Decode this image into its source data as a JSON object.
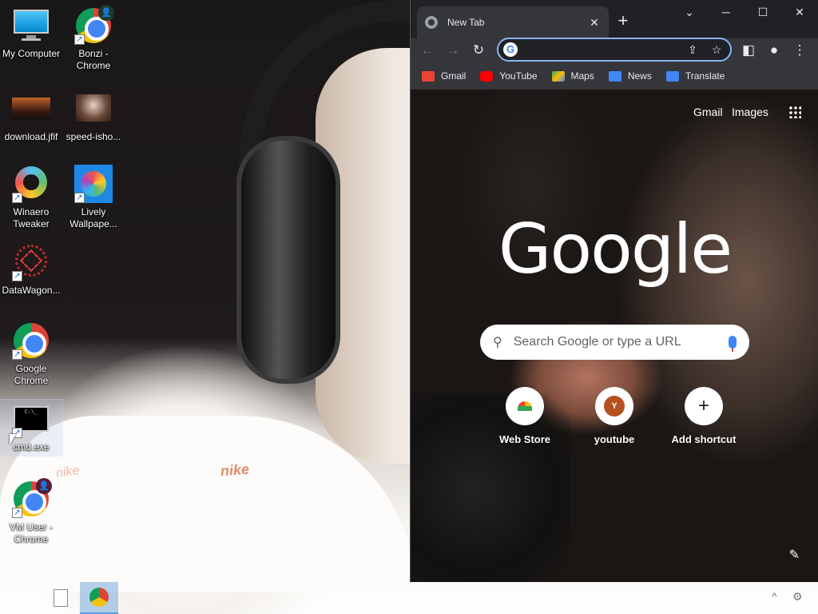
{
  "desktop": {
    "icons": [
      {
        "label": "My Computer"
      },
      {
        "label": "Bonzi - Chrome"
      },
      {
        "label": "download.jfif"
      },
      {
        "label": "speed-isho..."
      },
      {
        "label": "Winaero Tweaker"
      },
      {
        "label": "Lively Wallpape..."
      },
      {
        "label": "DataWagon..."
      },
      {
        "label": "Google Chrome"
      },
      {
        "label": "cmd.exe"
      },
      {
        "label": "VM User - Chrome"
      }
    ],
    "wallpaper_text": [
      "nike",
      "nike"
    ]
  },
  "browser": {
    "tab": {
      "title": "New Tab",
      "close": "✕"
    },
    "new_tab_symbol": "+",
    "window_controls": {
      "dropdown": "⌄",
      "minimize": "─",
      "maximize": "☐",
      "close": "✕"
    },
    "omnibox": {
      "value": "",
      "placeholder": ""
    },
    "bookmarks": [
      {
        "label": "Gmail",
        "icon": "gmail-icon",
        "color": "#ea4335"
      },
      {
        "label": "YouTube",
        "icon": "youtube-icon",
        "color": "#ff0000"
      },
      {
        "label": "Maps",
        "icon": "maps-icon",
        "color": "#34a853"
      },
      {
        "label": "News",
        "icon": "news-icon",
        "color": "#4285f4"
      },
      {
        "label": "Translate",
        "icon": "translate-icon",
        "color": "#4285f4"
      }
    ],
    "ntp": {
      "top_links": {
        "gmail": "Gmail",
        "images": "Images"
      },
      "logo": "Google",
      "search_placeholder": "Search Google or type a URL",
      "shortcuts": [
        {
          "label": "Web Store",
          "icon": "webstore-icon"
        },
        {
          "label": "youtube",
          "icon": "youtube-letter-icon",
          "letter": "Y"
        },
        {
          "label": "Add shortcut",
          "icon": "plus-icon"
        }
      ]
    }
  },
  "taskbar": {
    "items": [
      {
        "name": "file",
        "icon": "document-icon"
      },
      {
        "name": "chrome",
        "icon": "chrome-icon",
        "active": true
      }
    ],
    "tray": {
      "chevron": "^",
      "settings": "⚙"
    }
  }
}
